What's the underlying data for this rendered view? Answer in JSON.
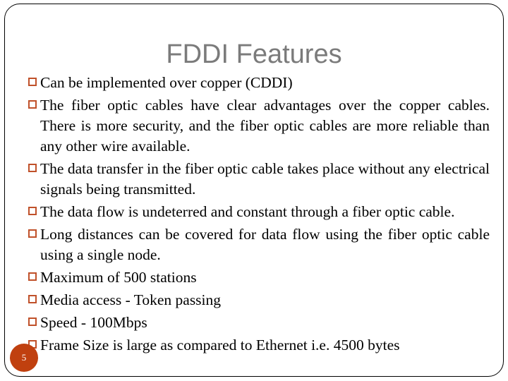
{
  "slide": {
    "title": "FDDI Features",
    "title_color": "#7b7b7b",
    "background_color": "#ffffff",
    "border_color": "#000000",
    "bullet_marker_color": "#c0512a",
    "bullet_marker_icon": "hollow-square-bullet-icon",
    "page_number": "5",
    "page_number_badge_color": "#c0400f",
    "bullets": [
      {
        "text": "Can be implemented over copper (CDDI)",
        "justified": false
      },
      {
        "text": "The fiber optic cables have clear advantages over the copper cables. There is more security, and the fiber optic cables are more reliable than any other wire available.",
        "justified": true
      },
      {
        "text": "The data transfer in the fiber optic cable takes place without any electrical signals being transmitted.",
        "justified": true
      },
      {
        "text": "The data flow is undeterred and constant through a fiber optic cable.",
        "justified": true
      },
      {
        "text": "Long distances can be covered for data flow using the fiber optic cable using a single node.",
        "justified": true
      },
      {
        "text": "Maximum of 500 stations",
        "justified": false
      },
      {
        "text": "Media access - Token passing",
        "justified": false
      },
      {
        "text": "Speed - 100Mbps",
        "justified": false
      },
      {
        "text": "Frame Size is large as compared to Ethernet i.e. 4500 bytes",
        "justified": false
      }
    ]
  }
}
